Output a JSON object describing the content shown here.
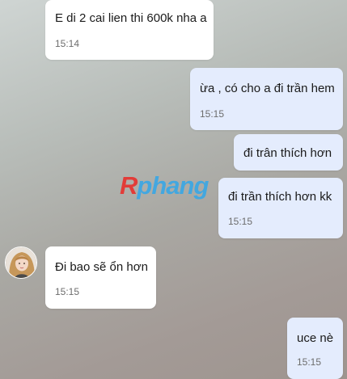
{
  "watermark": {
    "first_letter": "R",
    "rest": "phang",
    "first_color": "#e8302c",
    "rest_color": "#38a7e6"
  },
  "messages": [
    {
      "direction": "incoming",
      "text": "E di 2 cai lien thi 600k nha a",
      "time": "15:14"
    },
    {
      "direction": "outgoing",
      "text": "ừa , có cho a đi trần hem",
      "time": "15:15"
    },
    {
      "direction": "outgoing",
      "text": "đi trân thích hơn",
      "time": ""
    },
    {
      "direction": "outgoing",
      "text": "đi trần thích hơn kk",
      "time": "15:15"
    },
    {
      "direction": "incoming",
      "text": "Đi bao sẽ ổn hơn",
      "time": "15:15"
    },
    {
      "direction": "outgoing",
      "text": "uce nè",
      "time": "15:15"
    }
  ],
  "colors": {
    "incoming_bubble": "#ffffff",
    "outgoing_bubble": "#e4ecfd"
  }
}
